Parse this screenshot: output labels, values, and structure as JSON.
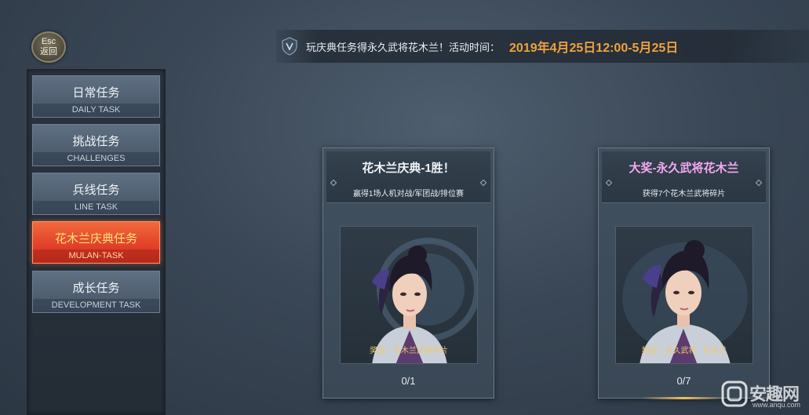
{
  "esc": {
    "key": "Esc",
    "label": "返回"
  },
  "banner": {
    "icon": "shield-emblem-icon",
    "text": "玩庆典任务得永久武将花木兰！活动时间：",
    "time": "2019年4月25日12:00-5月25日"
  },
  "sidebar": {
    "tabs": [
      {
        "cn": "日常任务",
        "en": "DAILY TASK",
        "active": false
      },
      {
        "cn": "挑战任务",
        "en": "CHALLENGES",
        "active": false
      },
      {
        "cn": "兵线任务",
        "en": "LINE TASK",
        "active": false
      },
      {
        "cn": "花木兰庆典任务",
        "en": "MULAN-TASK",
        "active": true
      },
      {
        "cn": "成长任务",
        "en": "DEVELOPMENT TASK",
        "active": false
      }
    ]
  },
  "cards": [
    {
      "title": "花木兰庆典-1胜！",
      "desc": "赢得1场人机对战/军团战/排位赛",
      "reward": "奖励：花木兰武将碎片",
      "progress": "0/1",
      "image": "mulan-portrait-fragment"
    },
    {
      "title": "大奖-永久武将花木兰",
      "desc": "获得7个花木兰武将碎片",
      "reward": "奖励：永久武将 · 花木兰",
      "progress": "0/7",
      "image": "mulan-portrait"
    }
  ],
  "watermark": {
    "text": "安趣网",
    "url": "www.anqu.com"
  },
  "colors": {
    "accent": "#f0a23c",
    "active_tab": "#e3422a",
    "reward": "#f0c870",
    "title_pink": "#f3a8f0"
  }
}
